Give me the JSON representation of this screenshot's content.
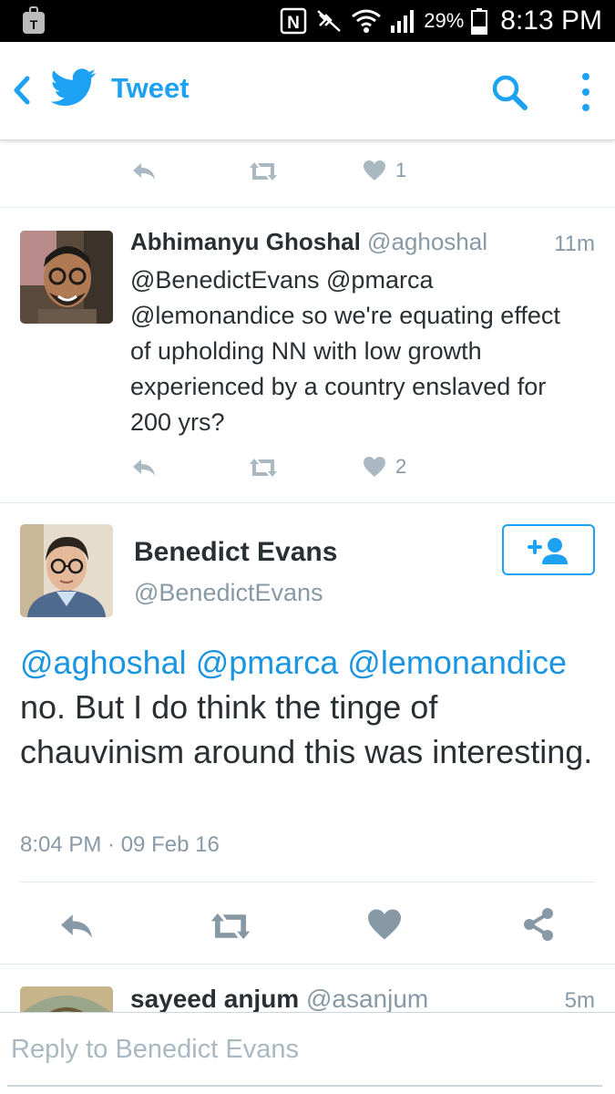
{
  "status_bar": {
    "battery": "29%",
    "time": "8:13 PM",
    "icons": [
      "carrier-icon",
      "nfc-icon",
      "mute-icon",
      "wifi-icon",
      "signal-icon",
      "battery-icon"
    ]
  },
  "toolbar": {
    "title": "Tweet",
    "icons": [
      "back-icon",
      "twitter-bird-icon",
      "search-icon",
      "overflow-menu-icon"
    ]
  },
  "previous_tweet": {
    "like_count": "1"
  },
  "reply_tweet": {
    "name": "Abhimanyu Ghoshal",
    "handle": "@aghoshal",
    "time": "11m",
    "text": "@BenedictEvans @pmarca @lemonandice so we're equating effect of upholding NN with low growth experienced by a country enslaved for 200 yrs?",
    "like_count": "2"
  },
  "main_tweet": {
    "name": "Benedict Evans",
    "handle": "@BenedictEvans",
    "mentions": [
      "@aghoshal",
      "@pmarca",
      "@lemonandice"
    ],
    "text": "no. But I do think the tinge of chauvinism around this was interesting.",
    "meta": "8:04 PM · 09 Feb 16",
    "follow_icon": "follow-add-user-icon"
  },
  "next_tweet": {
    "name": "sayeed anjum",
    "handle": "@asanjum",
    "time": "5m"
  },
  "reply_bar": {
    "placeholder": "Reply to Benedict Evans"
  },
  "colors": {
    "brand_blue": "#1da1f2",
    "mention_blue": "#1b95e0",
    "muted": "#8899a6",
    "action_icon": "#8899a6"
  }
}
